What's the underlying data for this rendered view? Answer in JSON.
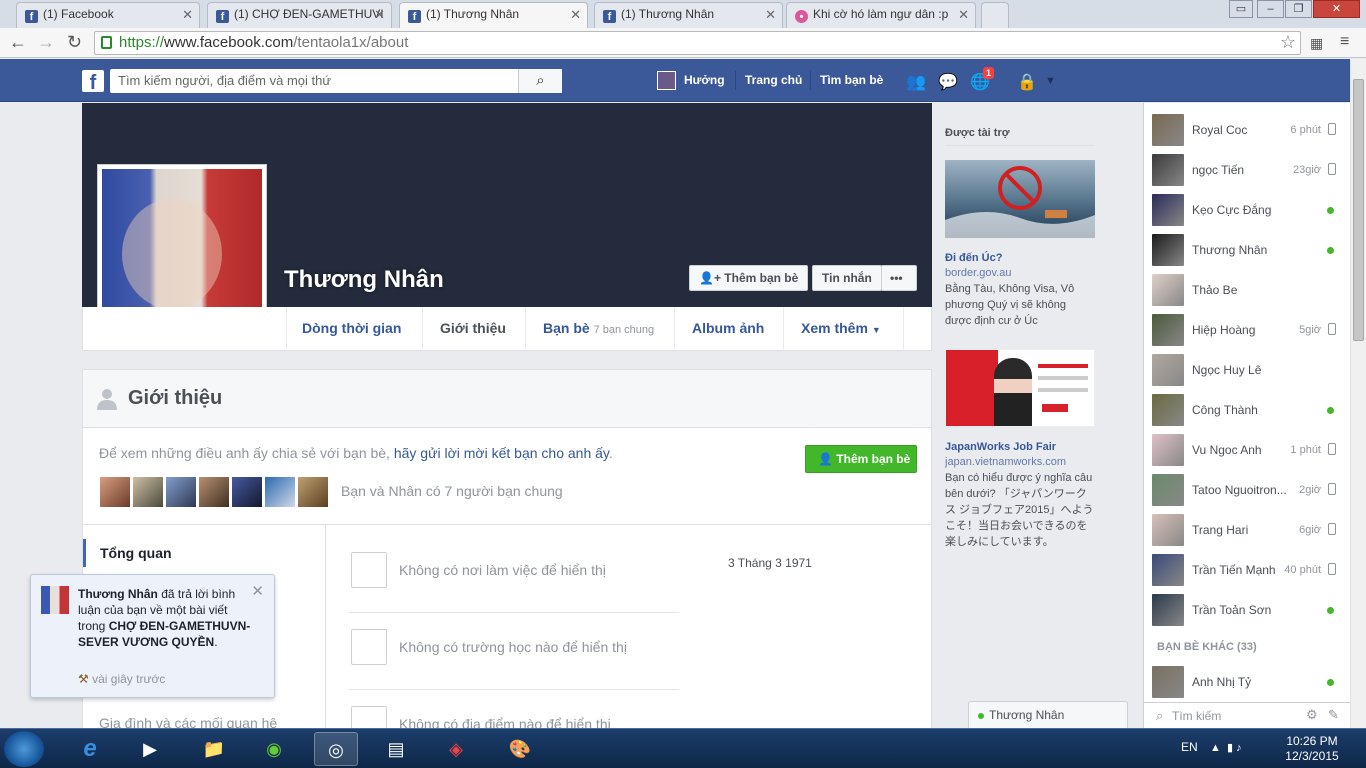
{
  "browser": {
    "tabs": [
      {
        "title": "(1) Facebook",
        "icon": "facebook-icon"
      },
      {
        "title": "(1) CHỢ ĐEN-GAMETHUVI",
        "icon": "facebook-icon"
      },
      {
        "title": "(1) Thương Nhân",
        "icon": "facebook-icon",
        "active": true
      },
      {
        "title": "(1) Thương Nhân",
        "icon": "facebook-icon"
      },
      {
        "title": "Khi cờ hó làm ngư dân :p",
        "icon": "pink-icon"
      }
    ],
    "url_scheme": "https://",
    "url_host": "www.facebook.com",
    "url_path": "/tentaola1x/about"
  },
  "fb_header": {
    "search_placeholder": "Tìm kiếm người, địa điểm và mọi thứ",
    "user_name": "Hưởng",
    "home": "Trang chủ",
    "find_friends": "Tìm bạn bè",
    "notif_count": "1"
  },
  "profile": {
    "name": "Thương Nhân",
    "add_friend": "Thêm bạn bè",
    "message": "Tin nhắn",
    "more": "•••",
    "tabs": {
      "timeline": "Dòng thời gian",
      "about": "Giới thiệu",
      "friends": "Bạn bè",
      "friends_sub": "7 bạn chung",
      "photos": "Album ảnh",
      "more": "Xem thêm"
    }
  },
  "intro": {
    "title": "Giới thiệu",
    "share_text": "Để xem những điều anh ấy chia sẻ với bạn bè,",
    "share_link": "hãy gửi lời mời kết bạn cho anh ấy",
    "share_end": ".",
    "add_friend": "Thêm bạn bè",
    "mutual_text": "Bạn và Nhân có 7 người bạn chung",
    "overview": "Tổng quan",
    "family_link": "Gia đình và các mối quan hệ",
    "rows": [
      "Không có nơi làm việc để hiển thị",
      "Không có trường học nào để hiển thị",
      "Không có địa điểm nào để hiển thị"
    ],
    "birthday": "3 Tháng 3 1971"
  },
  "notification": {
    "actor": "Thương Nhân",
    "text1": "đã trả lời bình luận của bạn về một bài viết trong",
    "group": "CHỢ ĐEN-GAMETHUVN-SEVER VƯƠNG QUYỀN",
    "end": ".",
    "time": "vài giây trước"
  },
  "ads": {
    "sponsored": "Được tài trợ",
    "items": [
      {
        "title": "Đi đến Úc?",
        "url": "border.gov.au",
        "text": "Bằng Tàu, Không Visa, Vô phương Quý vị sẽ không được định cư ở Úc"
      },
      {
        "title": "JapanWorks Job Fair",
        "url": "japan.vietnamworks.com",
        "text": "Bạn có hiểu được ý nghĩa câu bên dưới? 「ジャパンワークス ジョブフェア2015」へようこそ！当日お会いできるのを楽しみにしています。"
      }
    ]
  },
  "chat": {
    "friends": [
      {
        "name": "Royal Coc",
        "time": "6 phút",
        "status": "phone"
      },
      {
        "name": "ngọc Tiến",
        "time": "23giờ",
        "status": "phone"
      },
      {
        "name": "Kẹo Cực Đắng",
        "time": "",
        "status": "online"
      },
      {
        "name": "Thương Nhân",
        "time": "",
        "status": "online"
      },
      {
        "name": "Thảo Be",
        "time": "",
        "status": ""
      },
      {
        "name": "Hiệp Hoàng",
        "time": "5giờ",
        "status": "phone"
      },
      {
        "name": "Ngọc Huy Lê",
        "time": "",
        "status": ""
      },
      {
        "name": "Công Thành",
        "time": "",
        "status": "online"
      },
      {
        "name": "Vu Ngoc Anh",
        "time": "1 phút",
        "status": "phone"
      },
      {
        "name": "Tatoo Nguoitron...",
        "time": "2giờ",
        "status": "phone"
      },
      {
        "name": "Trang Hari",
        "time": "6giờ",
        "status": "phone"
      },
      {
        "name": "Trần Tiến Mạnh",
        "time": "40 phút",
        "status": "phone"
      },
      {
        "name": "Trần Toản Sơn",
        "time": "",
        "status": "online"
      }
    ],
    "other_header": "BẠN BÈ KHÁC (33)",
    "other_friends": [
      {
        "name": "Anh Nhị Tỷ",
        "time": "",
        "status": "online"
      }
    ],
    "search_placeholder": "Tìm kiếm",
    "open_chat": "Thương Nhân"
  },
  "taskbar": {
    "lang": "EN",
    "time": "10:26 PM",
    "date": "12/3/2015"
  }
}
